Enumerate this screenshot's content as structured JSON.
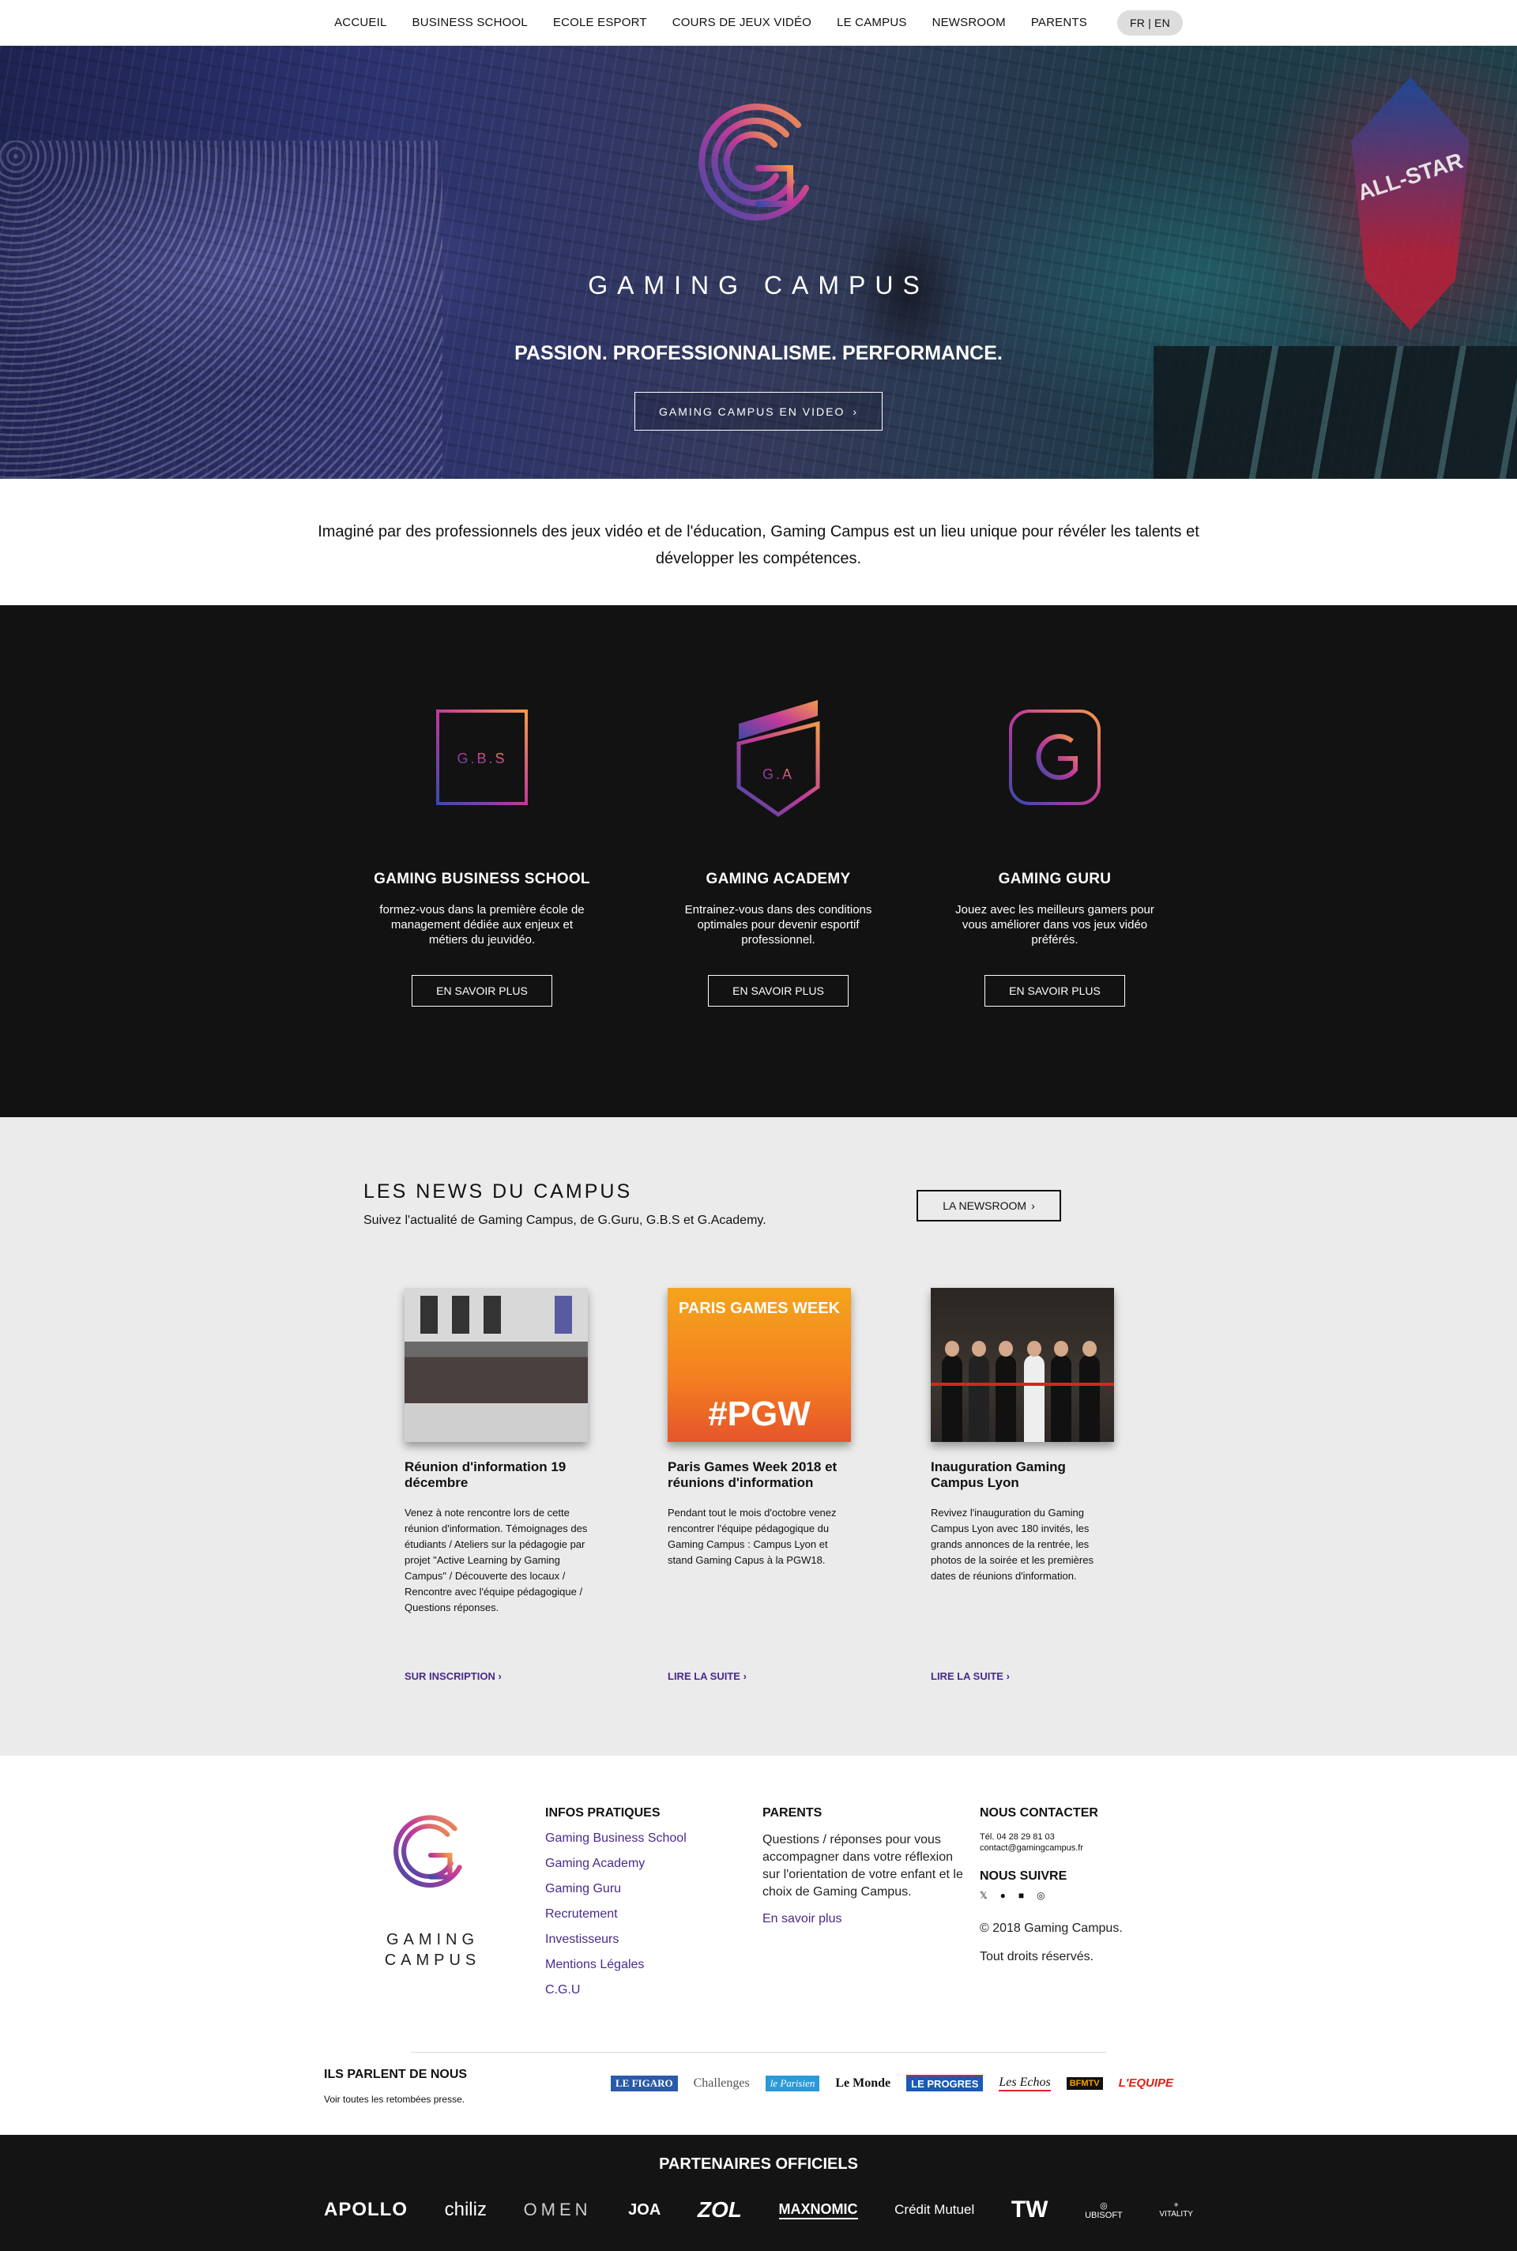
{
  "nav": {
    "items": [
      "ACCUEIL",
      "BUSINESS SCHOOL",
      "ECOLE ESPORT",
      "COURS DE JEUX VIDÉO",
      "LE CAMPUS",
      "NEWSROOM",
      "PARENTS"
    ],
    "lang": "FR | EN"
  },
  "hero": {
    "brand": "GAMING CAMPUS",
    "tagline": "PASSION. PROFESSIONNALISME. PERFORMANCE.",
    "button": "GAMING CAMPUS EN VIDEO",
    "badge_text": "ALL-STAR"
  },
  "intro": {
    "text": "Imaginé par des professionnels des jeux vidéo et de l'éducation, Gaming Campus est un lieu unique pour révéler les talents et développer les compétences."
  },
  "schools": [
    {
      "logo_text": "G.B.S",
      "title": "GAMING BUSINESS SCHOOL",
      "desc": "formez-vous dans la première école de management dédiée aux enjeux et métiers du jeuvidéo.",
      "button": "EN SAVOIR PLUS"
    },
    {
      "logo_text": "G.A",
      "title": "GAMING ACADEMY",
      "desc": "Entrainez-vous dans des conditions optimales pour devenir esportif professionnel.",
      "button": "EN SAVOIR PLUS"
    },
    {
      "logo_text": "G",
      "title": "GAMING GURU",
      "desc": "Jouez avec les meilleurs gamers pour vous améliorer dans vos jeux vidéo préférés.",
      "button": "EN SAVOIR PLUS"
    }
  ],
  "news": {
    "title": "LES NEWS DU CAMPUS",
    "subtitle": "Suivez l'actualité de Gaming Campus, de G.Guru, G.B.S et G.Academy.",
    "newsroom_button": "LA NEWSROOM",
    "cards": [
      {
        "title": "Réunion d'information 19 décembre",
        "text": "Venez à note rencontre lors de cette réunion d'information. Témoignages des étudiants / Ateliers sur la pédagogie par projet \"Active Learning by Gaming Campus\" / Découverte des locaux / Rencontre avec l'équipe pédagogique / Questions réponses.",
        "link": "SUR INSCRIPTION"
      },
      {
        "title": "Paris Games Week 2018 et réunions d'information",
        "text": "Pendant tout le mois d'octobre venez rencontrer l'équipe pédagogique du Gaming Campus : Campus Lyon et stand Gaming Capus à la PGW18.",
        "link": "LIRE LA SUITE",
        "img_top": "PARIS GAMES WEEK",
        "img_bottom": "#PGW"
      },
      {
        "title": "Inauguration Gaming Campus Lyon",
        "text": "Revivez l'inauguration du Gaming Campus Lyon avec 180 invités, les grands annonces de la rentrée, les photos de la soirée et les premières dates de réunions d'information.",
        "link": "LIRE LA SUITE"
      }
    ]
  },
  "footer": {
    "brand_line1": "GAMING",
    "brand_line2": "CAMPUS",
    "infos": {
      "title": "INFOS PRATIQUES",
      "links": [
        "Gaming Business School",
        "Gaming Academy",
        "Gaming Guru",
        "Recrutement",
        "Investisseurs",
        "Mentions Légales",
        "C.G.U"
      ]
    },
    "parents": {
      "title": "PARENTS",
      "text": "Questions / réponses pour vous accompagner dans votre réflexion sur l'orientation de votre enfant et le choix de Gaming Campus.",
      "link": "En savoir plus"
    },
    "contact": {
      "title": "NOUS CONTACTER",
      "phone": "Tél. 04 28 29 81 03",
      "email": "contact@gamingcampus.fr",
      "follow_title": "NOUS SUIVRE",
      "copyright": "© 2018 Gaming Campus.",
      "rights": "Tout droits réservés."
    },
    "press": {
      "title": "ILS PARLENT DE NOUS",
      "subtitle": "Voir toutes les retombées presse.",
      "logos": [
        "LE FIGARO",
        "Challenges",
        "le Parisien",
        "Le Monde",
        "LE PROGRES",
        "Les Echos",
        "BFMTV",
        "L'EQUIPE"
      ]
    }
  },
  "partners": {
    "title": "PARTENAIRES OFFICIELS",
    "logos": [
      "APOLLO",
      "chiliz",
      "OMEN",
      "JOA",
      "ZOL",
      "MAXNOMIC",
      "Crédit Mutuel",
      "TW",
      "UBISOFT",
      "VITALITY"
    ]
  },
  "colors": {
    "accent_purple": "#4a2a8a",
    "logo_orange": "#f07a4a",
    "logo_magenta": "#c03a9a",
    "logo_blue": "#3a4aa8",
    "dark_bg": "#121212",
    "news_bg": "#ebebeb"
  }
}
